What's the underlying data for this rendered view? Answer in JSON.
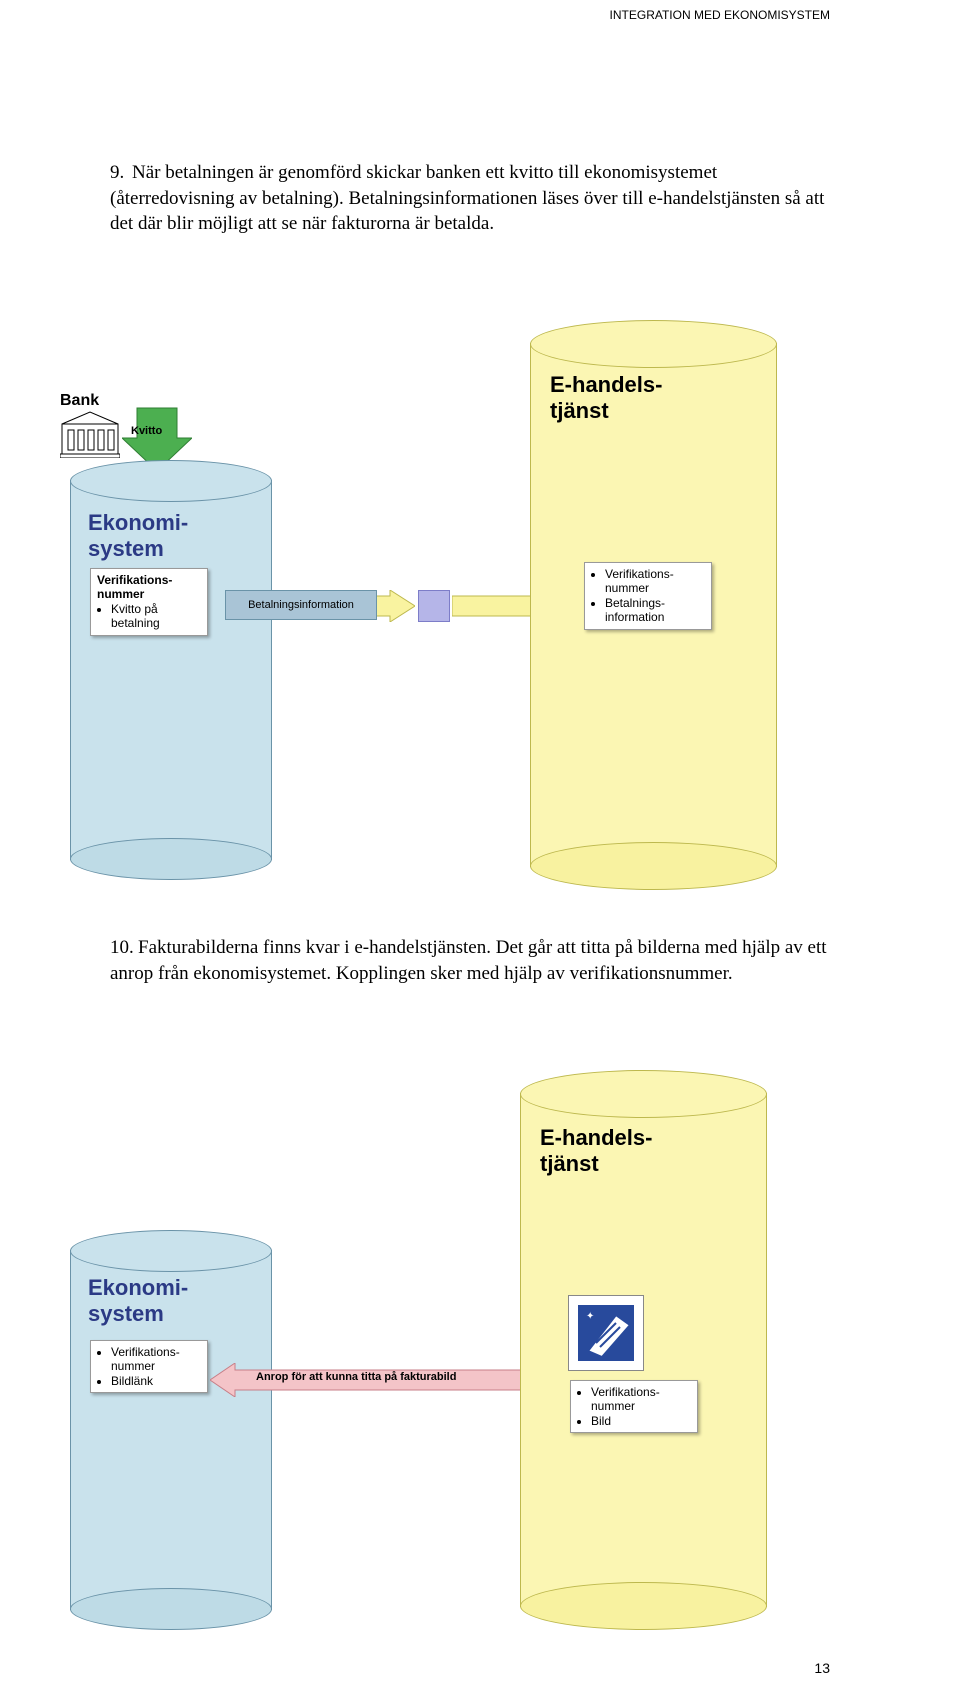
{
  "header": "INTEGRATION MED EKONOMISYSTEM",
  "page_number": "13",
  "para1_num": "9.",
  "para1": "När betalningen är genomförd skickar banken ett kvitto till ekonomisystemet (återredovisning av betalning). Betalningsinformationen läses över till e-handelstjänsten så att det där blir möjligt att se när fakturorna är betalda.",
  "para2_num": "10.",
  "para2": "Fakturabilderna finns kvar i e-handelstjänsten. Det går att titta på bilderna med hjälp av ett anrop från ekonomisystemet. Kopplingen sker med hjälp av verifikationsnummer.",
  "diagram1": {
    "bank": "Bank",
    "kvitto": "Kvitto",
    "ekonomi_title1": "Ekonomi-",
    "ekonomi_title2": "system",
    "ehandel_title1": "E-handels-",
    "ehandel_title2": "tjänst",
    "ekonomi_note_head": "Verifikations-\nnummer",
    "ekonomi_note_bullet": "Kvitto på betalning",
    "betalningsinfo": "Betalningsinformation",
    "ehandel_note_b1": "Verifikations-nummer",
    "ehandel_note_b2": "Betalnings-information"
  },
  "diagram2": {
    "ekonomi_title1": "Ekonomi-",
    "ekonomi_title2": "system",
    "ehandel_title1": "E-handels-",
    "ehandel_title2": "tjänst",
    "ekonomi_note_b1": "Verifikations-nummer",
    "ekonomi_note_b2": "Bildlänk",
    "arrow_text": "Anrop för att kunna titta på fakturabild",
    "ehandel_note_b1": "Verifikations-nummer",
    "ehandel_note_b2": "Bild"
  }
}
